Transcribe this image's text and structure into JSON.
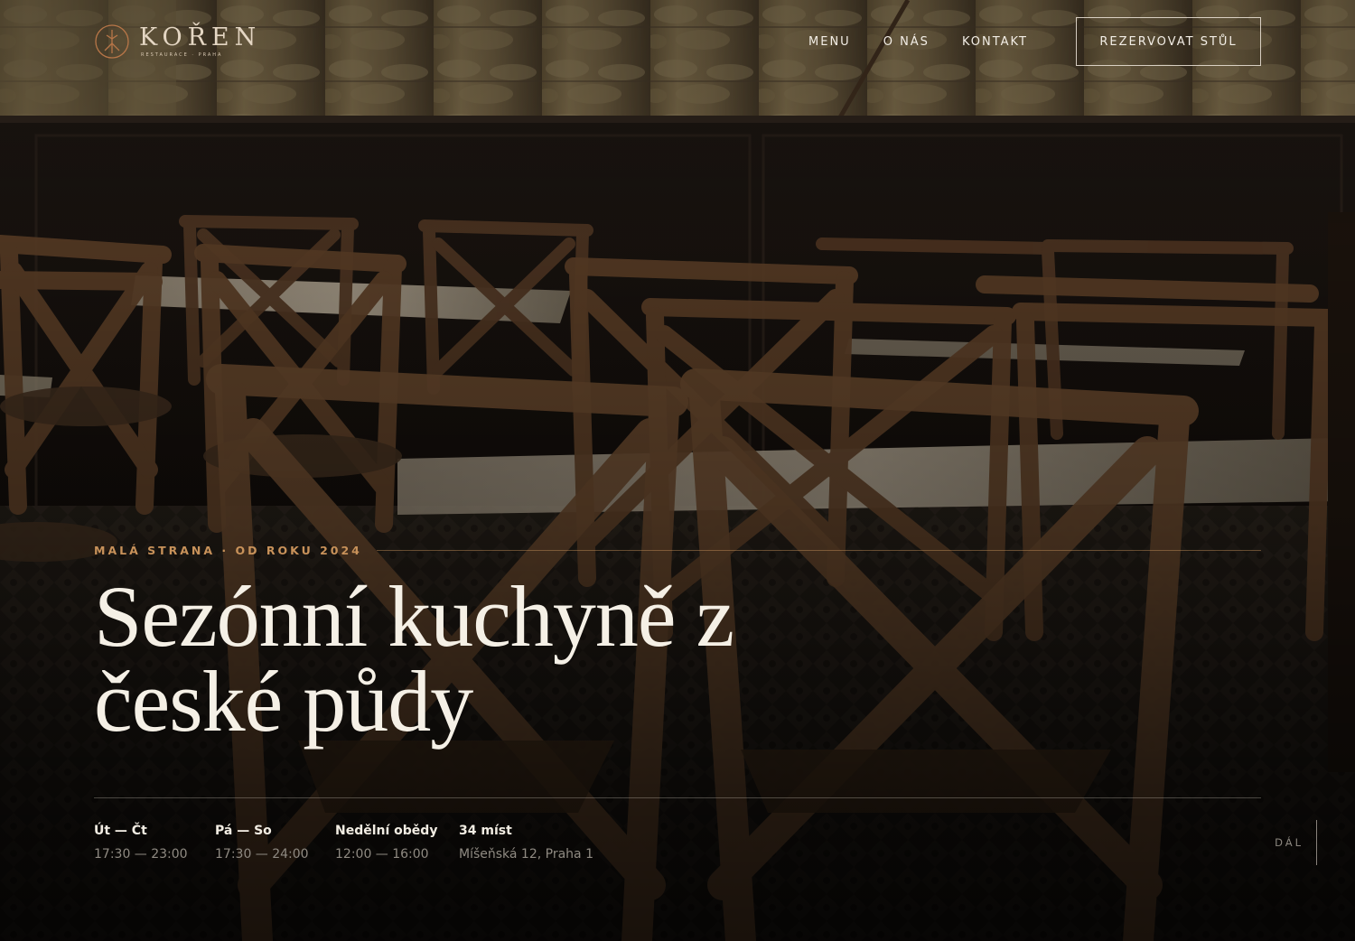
{
  "brand": {
    "name": "KOŘEN",
    "subtitle": "RESTAURACE · PRAHA",
    "accent_color": "#b87648",
    "logo_icon": "tree-root-icon"
  },
  "nav": {
    "links": [
      {
        "label": "MENU"
      },
      {
        "label": "O NÁS"
      },
      {
        "label": "KONTAKT"
      }
    ],
    "cta_label": "REZERVOVAT STŮL"
  },
  "hero": {
    "eyebrow": "MALÁ STRANA · OD ROKU 2024",
    "headline_line1": "Sezónní kuchyně z",
    "headline_line2": "české půdy",
    "eyebrow_color": "#c8925a"
  },
  "info": [
    {
      "label": "Út — Čt",
      "value": "17:30 — 23:00"
    },
    {
      "label": "Pá — So",
      "value": "17:30 — 24:00"
    },
    {
      "label": "Nedělní obědy",
      "value": "12:00 — 16:00"
    },
    {
      "label": "34 míst",
      "value": "Míšeňská 12, Praha 1"
    }
  ],
  "scroll_label": "DÁL",
  "background_image": "restaurant-interior-photo"
}
